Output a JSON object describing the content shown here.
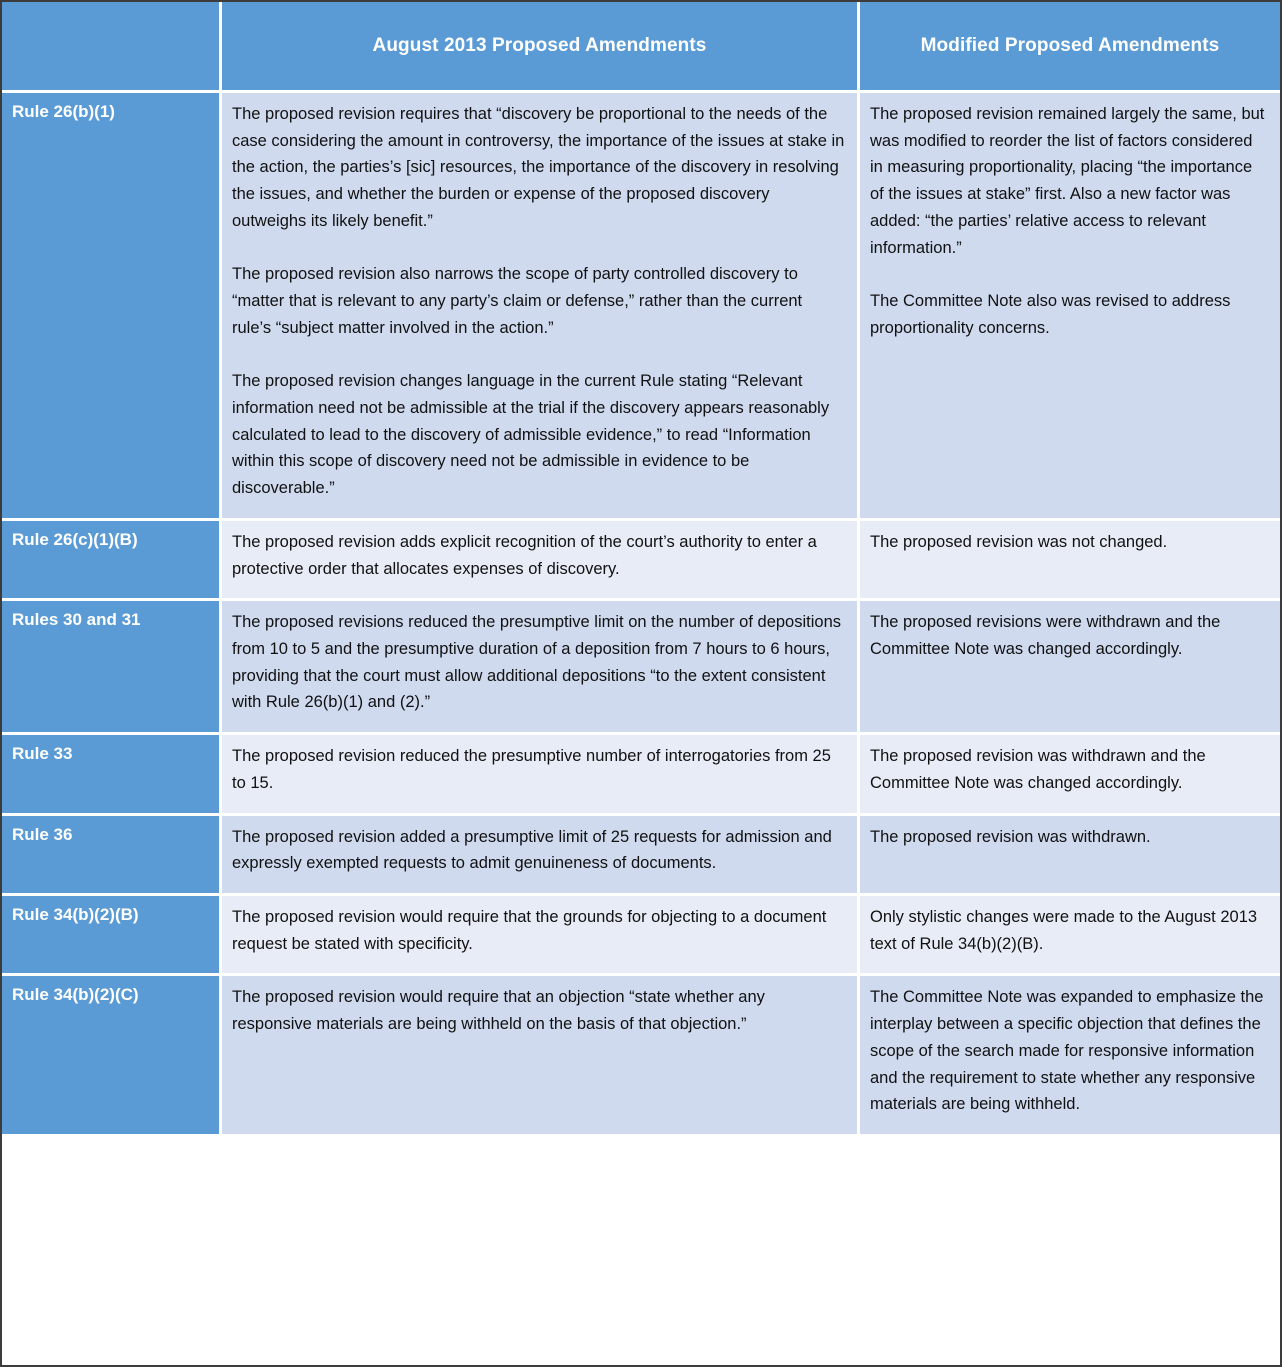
{
  "table": {
    "header": {
      "corner_label": "",
      "col_august": "August 2013 Proposed Amendments",
      "col_modified": "Modified Proposed Amendments"
    },
    "colors": {
      "header_blue": "#5B9BD5",
      "rule_blue": "#5B9BD5",
      "row_shade_dark": "#CFDAEF",
      "row_shade_light": "#E8ECF7",
      "header_text": "#FFFFFF",
      "body_text": "#111111",
      "outer_border": "#3C3C3C"
    },
    "rows": [
      {
        "rule": "Rule 26(b)(1)",
        "august": [
          "The proposed revision requires that “discovery be proportional to the needs of the case considering the amount in controversy, the importance of the issues at stake in the action, the parties’s [sic] resources, the importance of the discovery in resolving the issues, and whether the burden or expense of the proposed discovery outweighs its likely benefit.”",
          "The proposed revision also narrows the scope of party controlled discovery to “matter that is relevant to any party’s claim or defense,” rather than the current rule’s “subject matter involved in the action.”",
          "The proposed revision changes language in the current Rule stating “Relevant information need not be admissible at the trial if the discovery appears reasonably calculated to lead to the discovery of admissible evidence,” to read “Information within this scope of discovery need not be admissible in evidence to be discoverable.”"
        ],
        "modified": [
          "The proposed revision remained largely the same, but was modified to reorder the list of factors considered in measuring proportionality, placing “the importance of the issues at stake” first.  Also a new factor was added: “the parties’ relative access to relevant information.”",
          "The Committee Note also was revised to address proportionality concerns."
        ]
      },
      {
        "rule": "Rule 26(c)(1)(B)",
        "august": [
          "The proposed revision adds explicit recognition of the court’s authority to enter a protective order that allocates expenses of discovery."
        ],
        "modified": [
          "The proposed revision was not changed."
        ]
      },
      {
        "rule": "Rules 30 and 31",
        "august": [
          "The proposed revisions reduced the presumptive limit on the number of depositions from 10 to 5 and the presumptive duration of a deposition from 7 hours to 6 hours, providing that the court must allow additional depositions “to the extent consistent with Rule 26(b)(1) and (2).”"
        ],
        "modified": [
          "The proposed revisions were withdrawn and the Committee Note was changed accordingly."
        ]
      },
      {
        "rule": "Rule 33",
        "august": [
          "The proposed revision reduced the presumptive number of interrogatories from 25 to 15."
        ],
        "modified": [
          "The proposed revision was withdrawn and the Committee Note was changed accordingly."
        ]
      },
      {
        "rule": "Rule 36",
        "august": [
          "The proposed revision added a presumptive limit of 25 requests for admission and expressly exempted requests to admit genuineness of documents."
        ],
        "modified": [
          "The proposed revision was withdrawn."
        ]
      },
      {
        "rule": "Rule 34(b)(2)(B)",
        "august": [
          "The proposed revision would require that the grounds for objecting to a document request be stated with specificity."
        ],
        "modified": [
          "Only stylistic changes were made to the August 2013 text of Rule 34(b)(2)(B)."
        ]
      },
      {
        "rule": "Rule 34(b)(2)(C)",
        "august": [
          "The proposed revision would require that an objection “state whether any responsive materials are being withheld on the basis of that objection.”"
        ],
        "modified": [
          "The Committee Note was expanded to emphasize the interplay between a specific objection that defines the scope of the search made for responsive information and the requirement to state whether any responsive materials are being withheld."
        ]
      }
    ]
  }
}
